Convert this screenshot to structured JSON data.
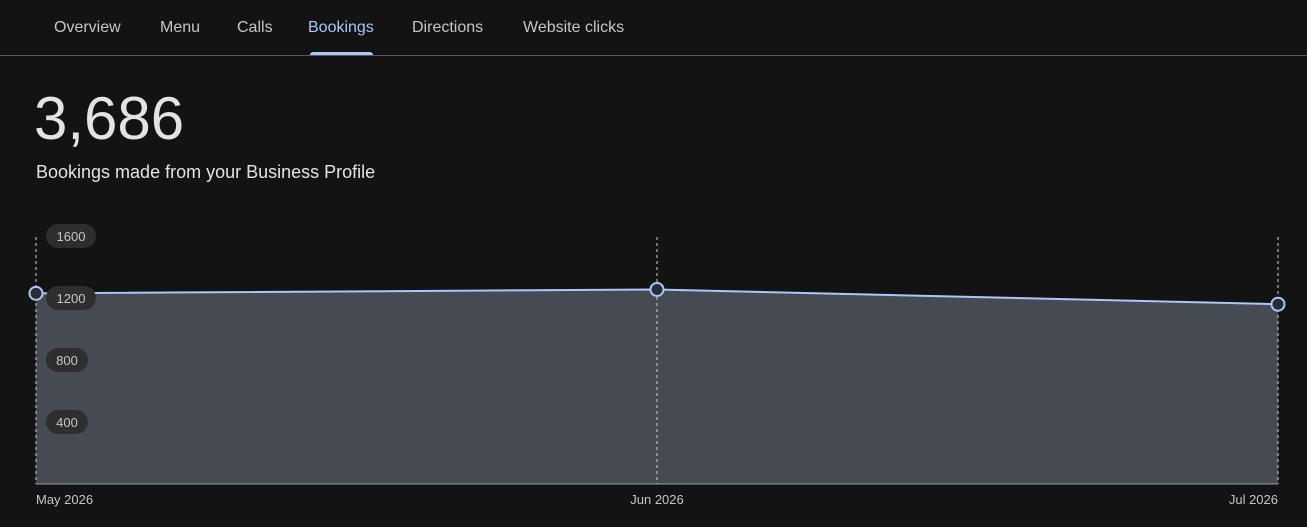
{
  "tabs": [
    {
      "label": "Overview",
      "active": false
    },
    {
      "label": "Menu",
      "active": false
    },
    {
      "label": "Calls",
      "active": false
    },
    {
      "label": "Bookings",
      "active": true
    },
    {
      "label": "Directions",
      "active": false
    },
    {
      "label": "Website clicks",
      "active": false
    }
  ],
  "summary": {
    "total": "3,686",
    "description": "Bookings made from your Business Profile"
  },
  "colors": {
    "accent": "#a8c7fa",
    "area_fill": "#464a52",
    "background": "#131313"
  },
  "chart_data": {
    "type": "area",
    "x": [
      "May 2026",
      "Jun 2026",
      "Jul 2026"
    ],
    "series": [
      {
        "values": [
          1230,
          1255,
          1160
        ]
      }
    ],
    "yticks": [
      "1600",
      "1200",
      "800",
      "400"
    ],
    "ylim": [
      0,
      1600
    ],
    "grid": "vertical-dashed"
  }
}
